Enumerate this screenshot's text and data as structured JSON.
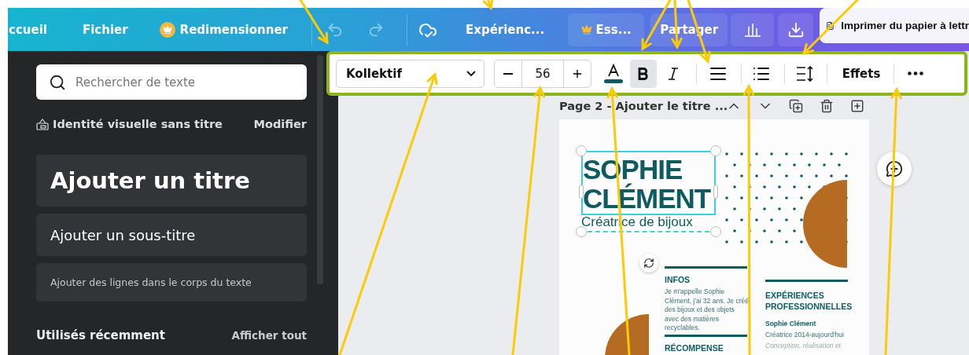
{
  "top_bar": {
    "home": "ccueil",
    "file": "Fichier",
    "resize": "Redimensionner",
    "undo": {
      "disabled": true
    },
    "redo": {
      "disabled": true
    },
    "status": "Expérienc...",
    "trial": "Ess...",
    "share": "Partager",
    "print_tab": "Imprimer du papier à lettr"
  },
  "sidebar": {
    "search": {
      "placeholder": "Rechercher de texte"
    },
    "brand_kit": "Identité visuelle sans titre",
    "edit": "Modifier",
    "presets": [
      {
        "kind": "heading",
        "label": "Ajouter un titre"
      },
      {
        "kind": "subheading",
        "label": "Ajouter un sous-titre"
      },
      {
        "kind": "body",
        "label": "Ajouter des lignes dans le corps du texte"
      }
    ],
    "recent": {
      "title": "Utilisés récemment",
      "see_all": "Afficher tout"
    }
  },
  "toolbar": {
    "font": "Kollektif",
    "font_size": "56",
    "bold": true,
    "italic": false,
    "effects": "Effets"
  },
  "page": {
    "header": "Page 2 - Ajouter le titre ...",
    "document": {
      "name_lines": [
        "SOPHIE",
        "CLÉMENT"
      ],
      "subtitle": "Créatrice de bijoux",
      "infos_title": "INFOS",
      "infos_text": "Je m'appelle Sophie Clément, j'ai 32 ans. Je créé des bijoux et des objets avec des matières recyclables.",
      "award_title": "RÉCOMPENSE",
      "experience_title": "EXPÉRIENCES PROFESSIONNELLES",
      "experience_name": "Sophie Clément",
      "experience_role": "Créatrice 2014-aujourd'hui",
      "experience_desc": "Conception, réalisation et"
    }
  }
}
